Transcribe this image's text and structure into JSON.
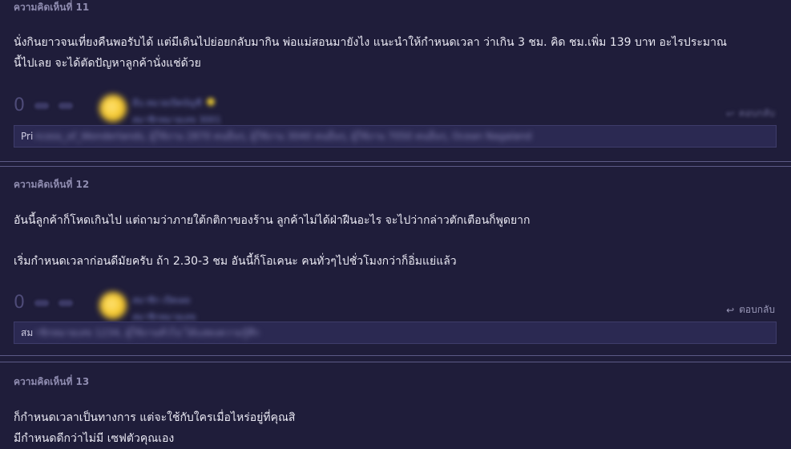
{
  "comments": [
    {
      "header": "ความคิดเห็นที่ 11",
      "lines": [
        "นั่งกินยาวจนเที่ยงคืนพอรับได้ แต่มีเดินไปย่อยกลับมากิน พ่อแม่สอนมายังไง แนะนำให้กำหนดเวลา ว่าเกิน 3 ชม. คิด ชม.เพิ่ม 139 บาท อะไรประมาณ",
        "นี้ไปเลย จะได้ตัดปัญหาลูกค้านั่งแช่ด้วย"
      ],
      "vote_count": "0",
      "author_name": "มีบ.หมวยเปิดบัญชี",
      "author_meta": "สมาชิกหมายเลข 3001",
      "reply_label": "ตอบกลับ",
      "reaction_prefix": "Pri",
      "reaction_hidden": "ncess_of_Wonderlands, ผู้ใช้งาน 2870 คนอื่นๆ, ผู้ใช้งาน 3040 คนอื่นๆ, ผู้ใช้งาน 7050 คนอื่นๆ, Ocean Nagaland"
    },
    {
      "header": "ความคิดเห็นที่ 12",
      "paragraphs": [
        "อันนี้ลูกค้าก็โหดเกินไป แต่ถามว่าภายใต้กติกาของร้าน ลูกค้าไม่ได้ฝ่าฝืนอะไร จะไปว่ากล่าวตักเตือนก็พูดยาก",
        "เริ่มกำหนดเวลาก่อนดีมัยครับ ถ้า 2.30-3 ชม อันนี้ก็โอเคนะ คนทั่วๆไปชั่วโมงกว่าก็อิ่มแย่แล้ว"
      ],
      "vote_count": "0",
      "author_name": "สมาชิก เปิดเผย",
      "author_meta": "สมาชิกหมายเลข",
      "reply_label": "ตอบกลับ",
      "reaction_prefix": "สม",
      "reaction_hidden": "าชิกหมายเลข 1234, ผู้ใช้งานทั่วไป ได้แสดงความรู้สึก"
    },
    {
      "header": "ความคิดเห็นที่ 13",
      "lines": [
        "ก็กำหนดเวลาเป็นทางการ แต่จะใช้กับใครเมื่อไหร่อยู่ที่คุณสิ",
        "มีกำหนดดีกว่าไม่มี เซฟตัวคุณเอง"
      ]
    }
  ],
  "colors": {
    "background": "#1f1d3a",
    "text": "#e9e8f2",
    "header": "#8f8cb0",
    "separator": "#5c5a86"
  }
}
